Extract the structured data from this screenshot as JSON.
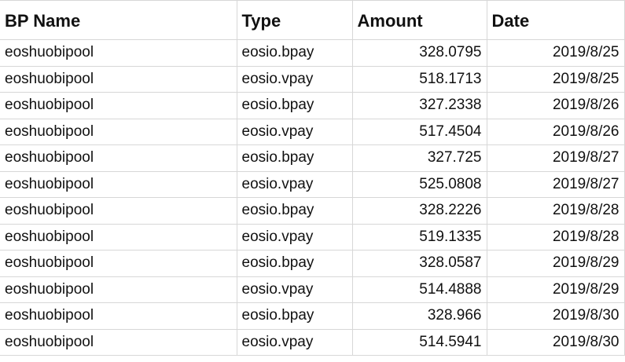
{
  "headers": {
    "bp_name": "BP Name",
    "type": "Type",
    "amount": "Amount",
    "date": "Date"
  },
  "rows": [
    {
      "bp_name": "eoshuobipool",
      "type": "eosio.bpay",
      "amount": "328.0795",
      "date": "2019/8/25"
    },
    {
      "bp_name": "eoshuobipool",
      "type": "eosio.vpay",
      "amount": "518.1713",
      "date": "2019/8/25"
    },
    {
      "bp_name": "eoshuobipool",
      "type": "eosio.bpay",
      "amount": "327.2338",
      "date": "2019/8/26"
    },
    {
      "bp_name": "eoshuobipool",
      "type": "eosio.vpay",
      "amount": "517.4504",
      "date": "2019/8/26"
    },
    {
      "bp_name": "eoshuobipool",
      "type": "eosio.bpay",
      "amount": "327.725",
      "date": "2019/8/27"
    },
    {
      "bp_name": "eoshuobipool",
      "type": "eosio.vpay",
      "amount": "525.0808",
      "date": "2019/8/27"
    },
    {
      "bp_name": "eoshuobipool",
      "type": "eosio.bpay",
      "amount": "328.2226",
      "date": "2019/8/28"
    },
    {
      "bp_name": "eoshuobipool",
      "type": "eosio.vpay",
      "amount": "519.1335",
      "date": "2019/8/28"
    },
    {
      "bp_name": "eoshuobipool",
      "type": "eosio.bpay",
      "amount": "328.0587",
      "date": "2019/8/29"
    },
    {
      "bp_name": "eoshuobipool",
      "type": "eosio.vpay",
      "amount": "514.4888",
      "date": "2019/8/29"
    },
    {
      "bp_name": "eoshuobipool",
      "type": "eosio.bpay",
      "amount": "328.966",
      "date": "2019/8/30"
    },
    {
      "bp_name": "eoshuobipool",
      "type": "eosio.vpay",
      "amount": "514.5941",
      "date": "2019/8/30"
    }
  ]
}
